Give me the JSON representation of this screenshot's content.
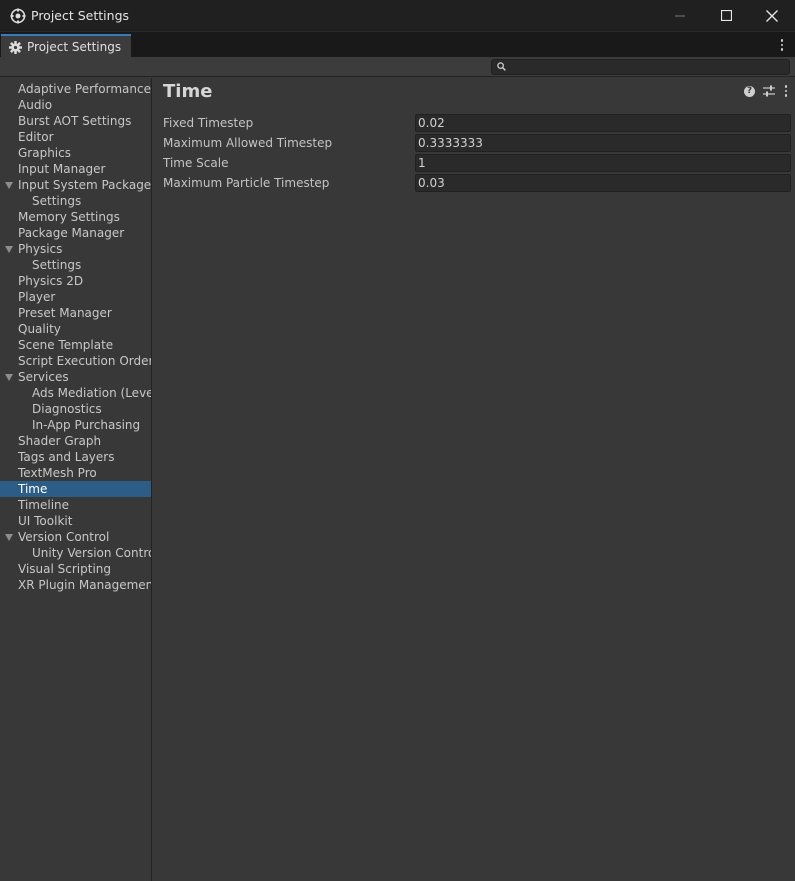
{
  "window": {
    "title": "Project Settings",
    "icon": "unity-settings-icon",
    "controls": [
      "minimize-icon",
      "maximize-icon",
      "close-icon"
    ]
  },
  "tab": {
    "label": "Project Settings",
    "icon": "gear-icon"
  },
  "search": {
    "value": "",
    "placeholder": ""
  },
  "sidebar": {
    "items": [
      {
        "label": "Adaptive Performance",
        "level": 0
      },
      {
        "label": "Audio",
        "level": 0
      },
      {
        "label": "Burst AOT Settings",
        "level": 0
      },
      {
        "label": "Editor",
        "level": 0
      },
      {
        "label": "Graphics",
        "level": 0
      },
      {
        "label": "Input Manager",
        "level": 0
      },
      {
        "label": "Input System Package",
        "level": 0,
        "expanded": true
      },
      {
        "label": "Settings",
        "level": 1
      },
      {
        "label": "Memory Settings",
        "level": 0
      },
      {
        "label": "Package Manager",
        "level": 0
      },
      {
        "label": "Physics",
        "level": 0,
        "expanded": true
      },
      {
        "label": "Settings",
        "level": 1
      },
      {
        "label": "Physics 2D",
        "level": 0
      },
      {
        "label": "Player",
        "level": 0
      },
      {
        "label": "Preset Manager",
        "level": 0
      },
      {
        "label": "Quality",
        "level": 0
      },
      {
        "label": "Scene Template",
        "level": 0
      },
      {
        "label": "Script Execution Order",
        "level": 0
      },
      {
        "label": "Services",
        "level": 0,
        "expanded": true
      },
      {
        "label": "Ads Mediation (Level",
        "level": 1
      },
      {
        "label": "Diagnostics",
        "level": 1
      },
      {
        "label": "In-App Purchasing",
        "level": 1
      },
      {
        "label": "Shader Graph",
        "level": 0
      },
      {
        "label": "Tags and Layers",
        "level": 0
      },
      {
        "label": "TextMesh Pro",
        "level": 0
      },
      {
        "label": "Time",
        "level": 0,
        "selected": true
      },
      {
        "label": "Timeline",
        "level": 0
      },
      {
        "label": "UI Toolkit",
        "level": 0
      },
      {
        "label": "Version Control",
        "level": 0,
        "expanded": true
      },
      {
        "label": "Unity Version Control",
        "level": 1
      },
      {
        "label": "Visual Scripting",
        "level": 0
      },
      {
        "label": "XR Plugin Management",
        "level": 0
      }
    ]
  },
  "main": {
    "title": "Time",
    "header_icons": [
      "help-icon",
      "preset-sliders-icon",
      "more-menu-icon"
    ],
    "fields": [
      {
        "label": "Fixed Timestep",
        "value": "0.02"
      },
      {
        "label": "Maximum Allowed Timestep",
        "value": "0.3333333"
      },
      {
        "label": "Time Scale",
        "value": "1"
      },
      {
        "label": "Maximum Particle Timestep",
        "value": "0.03"
      }
    ]
  },
  "colors": {
    "selection": "#2c5d87",
    "tab_accent": "#3a79bb",
    "background": "#383838"
  }
}
